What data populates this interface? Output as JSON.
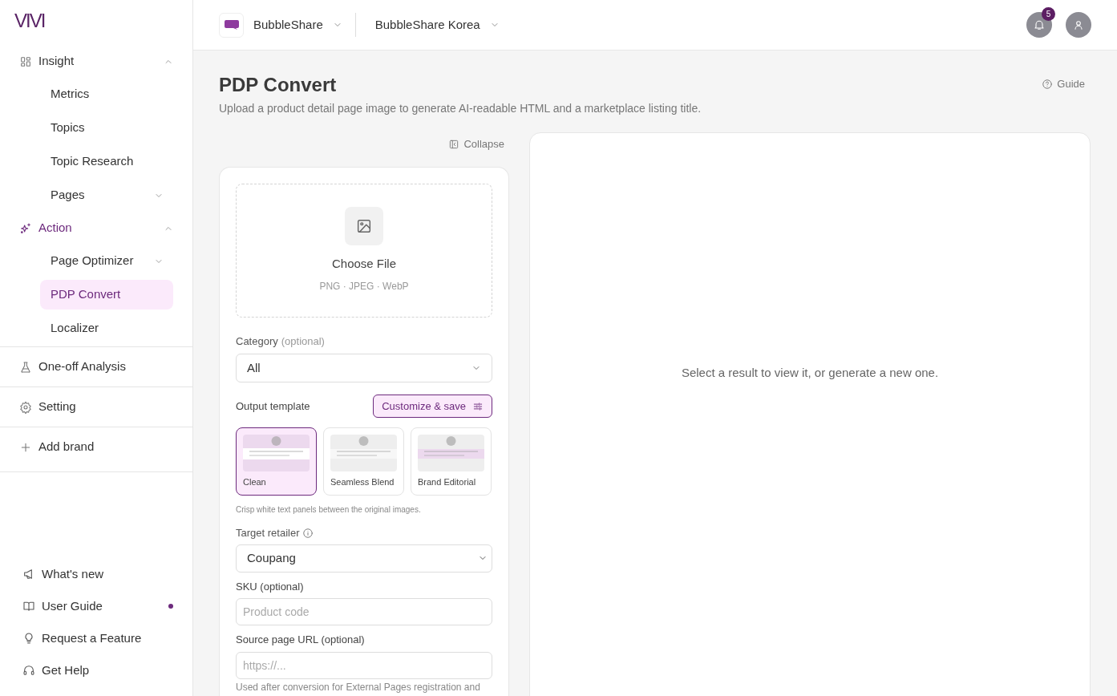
{
  "sidebar": {
    "logo": "VIVI",
    "nav": [
      {
        "label": "Insight",
        "kind": "group",
        "expanded": true,
        "selected": false,
        "children": [
          {
            "label": "Metrics",
            "kind": "link",
            "selected": false
          },
          {
            "label": "Topics",
            "kind": "link",
            "selected": false
          },
          {
            "label": "Topic Research",
            "kind": "link",
            "selected": false
          },
          {
            "label": "Pages",
            "kind": "group",
            "expanded": false,
            "selected": false
          }
        ]
      },
      {
        "label": "Action",
        "kind": "group",
        "expanded": true,
        "selected": true,
        "children": [
          {
            "label": "Page Optimizer",
            "kind": "group",
            "expanded": false,
            "selected": false
          },
          {
            "label": "PDP Convert",
            "kind": "link",
            "selected": true
          },
          {
            "label": "Localizer",
            "kind": "link",
            "selected": false
          }
        ]
      },
      {
        "label": "One-off Analysis",
        "kind": "link",
        "selected": false
      },
      {
        "label": "Setting",
        "kind": "link",
        "selected": false
      },
      {
        "label": "Add brand",
        "kind": "link",
        "selected": false
      }
    ],
    "footer": [
      {
        "label": "What's new",
        "unread": false
      },
      {
        "label": "User Guide",
        "unread": true
      },
      {
        "label": "Request a Feature",
        "unread": false
      },
      {
        "label": "Get Help",
        "unread": false
      }
    ]
  },
  "header": {
    "brand": "BubbleShare",
    "workspace": "BubbleShare Korea",
    "notifications": "5"
  },
  "page": {
    "title": "PDP Convert",
    "subtitle": "Upload a product detail page image to generate AI-readable HTML and a marketplace listing title.",
    "guide": "Guide",
    "collapse": "Collapse"
  },
  "upload": {
    "label": "Choose File",
    "formats": "PNG · JPEG · WebP"
  },
  "category": {
    "label": "Category",
    "hint": "(optional)",
    "value": "All"
  },
  "template": {
    "label": "Output template",
    "customize": "Customize & save",
    "options": [
      {
        "label": "Clean",
        "kind": "clean",
        "selected": true
      },
      {
        "label": "Seamless Blend",
        "kind": "blend",
        "selected": false
      },
      {
        "label": "Brand Editorial",
        "kind": "editorial",
        "selected": false
      }
    ],
    "description": "Crisp white text panels between the original images."
  },
  "retailer": {
    "label": "Target retailer",
    "value": "Coupang"
  },
  "sku": {
    "label": "SKU (optional)",
    "placeholder": "Product code"
  },
  "source_url": {
    "label": "Source page URL (optional)",
    "placeholder": "https://...",
    "help": "Used after conversion for External Pages registration and"
  },
  "result": {
    "empty": "Select a result to view it, or generate a new one."
  }
}
